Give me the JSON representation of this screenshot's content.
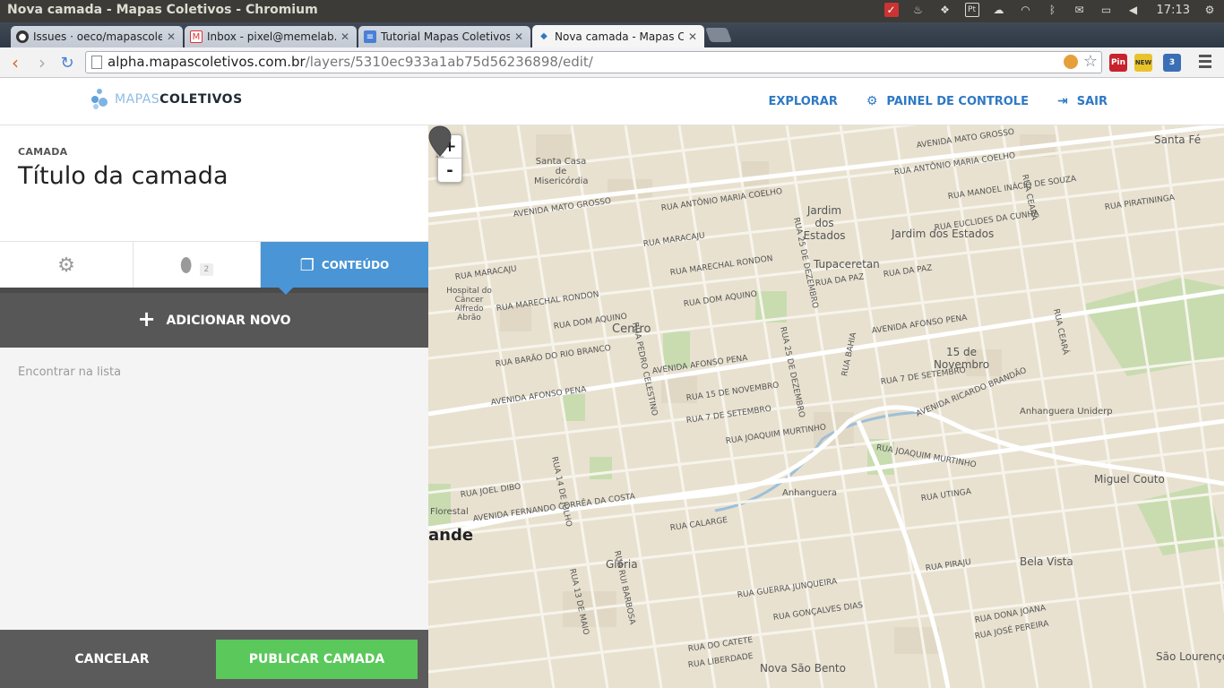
{
  "os": {
    "window_title": "Nova camada - Mapas Coletivos - Chromium",
    "clock": "17:13",
    "tray_badge": "Pt"
  },
  "tabs": [
    {
      "label": "Issues · oeco/mapascoletiv",
      "icon": "github-icon"
    },
    {
      "label": "Inbox - pixel@memelab.co",
      "icon": "gmail-icon"
    },
    {
      "label": "Tutorial Mapas Coletivos -",
      "icon": "docs-icon"
    },
    {
      "label": "Nova camada - Mapas Cole",
      "icon": "mapas-icon"
    }
  ],
  "address": {
    "host": "alpha.mapascoletivos.com.br",
    "path": "/layers/5310ec933a1ab75d56236898/edit/"
  },
  "extensions": {
    "pin": "Pin",
    "new_badge": "NEW",
    "count": "3"
  },
  "app": {
    "logo_light": "MAPAS",
    "logo_bold": "COLETIVOS",
    "nav": {
      "explore": "EXPLORAR",
      "dashboard": "PAINEL DE CONTROLE",
      "logout": "SAIR"
    }
  },
  "panel": {
    "eyebrow": "CAMADA",
    "title": "Título da camada",
    "tabs": {
      "features_count": "2",
      "content": "CONTEÚDO"
    },
    "add_new": "ADICIONAR NOVO",
    "search_placeholder": "Encontrar na lista",
    "cancel": "CANCELAR",
    "publish": "PUBLICAR CAMADA"
  },
  "map": {
    "zoom_in": "+",
    "zoom_out": "-",
    "labels": [
      "AVENIDA MATO GROSSO",
      "RUA ANTÔNIO MARIA COELHO",
      "AVENIDA AFONSO PENA",
      "RUA 15 DE NOVEMBRO",
      "RUA 7 DE SETEMBRO",
      "RUA JOAQUIM MURTINHO",
      "AVENIDA FERNANDO CORRÊA DA COSTA",
      "AVENIDA RICARDO BRANDÃO",
      "RUA MARACAJU",
      "RUA MARECHAL RONDON",
      "RUA DOM AQUINO",
      "RUA BARÃO DO RIO BRANCO",
      "RUA 14 DE JULHO",
      "RUA PEDRO CELESTINO",
      "RUA 25 DE DEZEMBRO",
      "RUA DA PAZ",
      "RUA BAHIA",
      "RUA CEARÁ",
      "RUA EUCLIDES DA CUNHA",
      "RUA MANOEL INÁCIO DE SOUZA",
      "RUA PIRATININGA",
      "RUA JOEL DIBO",
      "RUA RUI BARBOSA",
      "RUA 13 DE MAIO",
      "RUA CALARGE",
      "RUA UTINGA",
      "RUA PIRAJU",
      "RUA GUERRA JUNQUEIRA",
      "RUA GONÇALVES DIAS",
      "RUA DO CATETE",
      "RUA LIBERDADE",
      "RUA DONA JOANA",
      "RUA JOSÉ PEREIRA"
    ],
    "areas": [
      "Santa Casa de Misericórdia",
      "Jardim dos Estados",
      "Jardim dos Estados",
      "Tupaceretan",
      "Centro",
      "15 de Novembro",
      "Anhanguera Uniderp",
      "Miguel Couto",
      "Anhanguera",
      "Bela Vista",
      "Glória",
      "Nova São Bento",
      "São Lourenço",
      "Hospital do Câncer Alfredo Abrão",
      "Florestal",
      "Santa Fé"
    ],
    "city_fragment": "ande"
  }
}
